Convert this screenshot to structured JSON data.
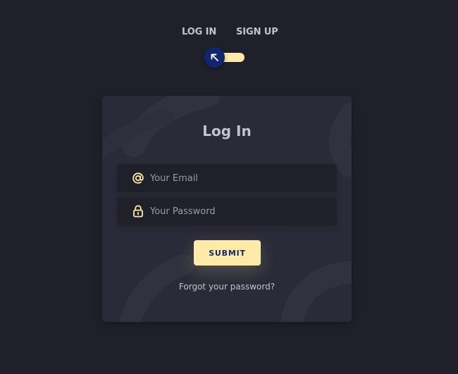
{
  "tabs": {
    "login_label": "LOG IN",
    "signup_label": "SIGN UP"
  },
  "toggle": {
    "icon": "arrow-up-left-icon"
  },
  "card": {
    "title": "Log In",
    "email": {
      "placeholder": "Your Email",
      "value": "",
      "icon": "at-sign-icon"
    },
    "password": {
      "placeholder": "Your Password",
      "value": "",
      "icon": "lock-icon"
    },
    "submit_label": "SUBMIT",
    "forgot_label": "Forgot your password?"
  },
  "colors": {
    "background": "#1f2029",
    "card": "#2a2b38",
    "accent": "#ffeba7",
    "knob": "#102770",
    "text": "#c4c3ca"
  }
}
